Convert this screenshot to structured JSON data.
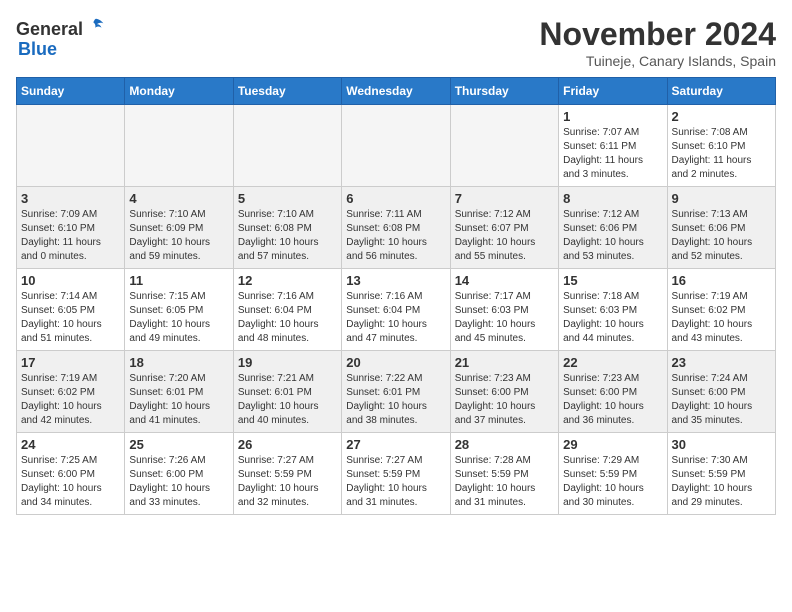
{
  "header": {
    "logo_general": "General",
    "logo_blue": "Blue",
    "month_title": "November 2024",
    "location": "Tuineje, Canary Islands, Spain"
  },
  "days_of_week": [
    "Sunday",
    "Monday",
    "Tuesday",
    "Wednesday",
    "Thursday",
    "Friday",
    "Saturday"
  ],
  "weeks": [
    [
      {
        "day": "",
        "info": ""
      },
      {
        "day": "",
        "info": ""
      },
      {
        "day": "",
        "info": ""
      },
      {
        "day": "",
        "info": ""
      },
      {
        "day": "",
        "info": ""
      },
      {
        "day": "1",
        "info": "Sunrise: 7:07 AM\nSunset: 6:11 PM\nDaylight: 11 hours\nand 3 minutes."
      },
      {
        "day": "2",
        "info": "Sunrise: 7:08 AM\nSunset: 6:10 PM\nDaylight: 11 hours\nand 2 minutes."
      }
    ],
    [
      {
        "day": "3",
        "info": "Sunrise: 7:09 AM\nSunset: 6:10 PM\nDaylight: 11 hours\nand 0 minutes."
      },
      {
        "day": "4",
        "info": "Sunrise: 7:10 AM\nSunset: 6:09 PM\nDaylight: 10 hours\nand 59 minutes."
      },
      {
        "day": "5",
        "info": "Sunrise: 7:10 AM\nSunset: 6:08 PM\nDaylight: 10 hours\nand 57 minutes."
      },
      {
        "day": "6",
        "info": "Sunrise: 7:11 AM\nSunset: 6:08 PM\nDaylight: 10 hours\nand 56 minutes."
      },
      {
        "day": "7",
        "info": "Sunrise: 7:12 AM\nSunset: 6:07 PM\nDaylight: 10 hours\nand 55 minutes."
      },
      {
        "day": "8",
        "info": "Sunrise: 7:12 AM\nSunset: 6:06 PM\nDaylight: 10 hours\nand 53 minutes."
      },
      {
        "day": "9",
        "info": "Sunrise: 7:13 AM\nSunset: 6:06 PM\nDaylight: 10 hours\nand 52 minutes."
      }
    ],
    [
      {
        "day": "10",
        "info": "Sunrise: 7:14 AM\nSunset: 6:05 PM\nDaylight: 10 hours\nand 51 minutes."
      },
      {
        "day": "11",
        "info": "Sunrise: 7:15 AM\nSunset: 6:05 PM\nDaylight: 10 hours\nand 49 minutes."
      },
      {
        "day": "12",
        "info": "Sunrise: 7:16 AM\nSunset: 6:04 PM\nDaylight: 10 hours\nand 48 minutes."
      },
      {
        "day": "13",
        "info": "Sunrise: 7:16 AM\nSunset: 6:04 PM\nDaylight: 10 hours\nand 47 minutes."
      },
      {
        "day": "14",
        "info": "Sunrise: 7:17 AM\nSunset: 6:03 PM\nDaylight: 10 hours\nand 45 minutes."
      },
      {
        "day": "15",
        "info": "Sunrise: 7:18 AM\nSunset: 6:03 PM\nDaylight: 10 hours\nand 44 minutes."
      },
      {
        "day": "16",
        "info": "Sunrise: 7:19 AM\nSunset: 6:02 PM\nDaylight: 10 hours\nand 43 minutes."
      }
    ],
    [
      {
        "day": "17",
        "info": "Sunrise: 7:19 AM\nSunset: 6:02 PM\nDaylight: 10 hours\nand 42 minutes."
      },
      {
        "day": "18",
        "info": "Sunrise: 7:20 AM\nSunset: 6:01 PM\nDaylight: 10 hours\nand 41 minutes."
      },
      {
        "day": "19",
        "info": "Sunrise: 7:21 AM\nSunset: 6:01 PM\nDaylight: 10 hours\nand 40 minutes."
      },
      {
        "day": "20",
        "info": "Sunrise: 7:22 AM\nSunset: 6:01 PM\nDaylight: 10 hours\nand 38 minutes."
      },
      {
        "day": "21",
        "info": "Sunrise: 7:23 AM\nSunset: 6:00 PM\nDaylight: 10 hours\nand 37 minutes."
      },
      {
        "day": "22",
        "info": "Sunrise: 7:23 AM\nSunset: 6:00 PM\nDaylight: 10 hours\nand 36 minutes."
      },
      {
        "day": "23",
        "info": "Sunrise: 7:24 AM\nSunset: 6:00 PM\nDaylight: 10 hours\nand 35 minutes."
      }
    ],
    [
      {
        "day": "24",
        "info": "Sunrise: 7:25 AM\nSunset: 6:00 PM\nDaylight: 10 hours\nand 34 minutes."
      },
      {
        "day": "25",
        "info": "Sunrise: 7:26 AM\nSunset: 6:00 PM\nDaylight: 10 hours\nand 33 minutes."
      },
      {
        "day": "26",
        "info": "Sunrise: 7:27 AM\nSunset: 5:59 PM\nDaylight: 10 hours\nand 32 minutes."
      },
      {
        "day": "27",
        "info": "Sunrise: 7:27 AM\nSunset: 5:59 PM\nDaylight: 10 hours\nand 31 minutes."
      },
      {
        "day": "28",
        "info": "Sunrise: 7:28 AM\nSunset: 5:59 PM\nDaylight: 10 hours\nand 31 minutes."
      },
      {
        "day": "29",
        "info": "Sunrise: 7:29 AM\nSunset: 5:59 PM\nDaylight: 10 hours\nand 30 minutes."
      },
      {
        "day": "30",
        "info": "Sunrise: 7:30 AM\nSunset: 5:59 PM\nDaylight: 10 hours\nand 29 minutes."
      }
    ]
  ]
}
